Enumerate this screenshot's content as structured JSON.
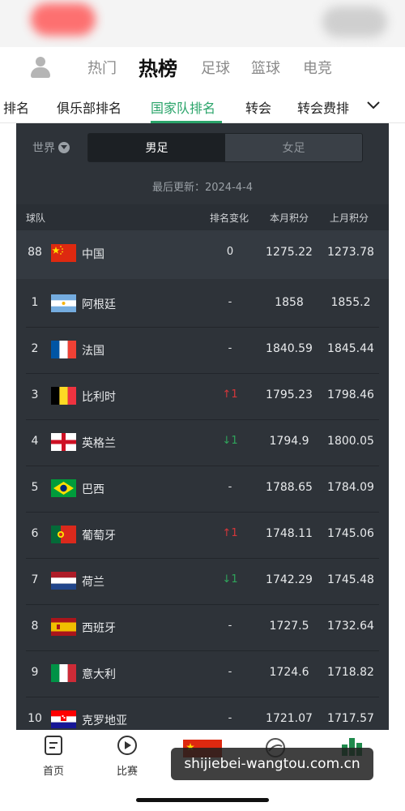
{
  "top_tabs": [
    "热门",
    "热榜",
    "足球",
    "篮球",
    "电竞"
  ],
  "sub_tabs": [
    "排名",
    "俱乐部排名",
    "国家队排名",
    "转会",
    "转会费排"
  ],
  "filter": {
    "region": "世界",
    "segments": [
      "男足",
      "女足"
    ]
  },
  "updated": "最后更新：2024-4-4",
  "columns": {
    "team": "球队",
    "change": "排名变化",
    "current": "本月积分",
    "previous": "上月积分"
  },
  "teams": [
    {
      "rank": "88",
      "flag": "china-flag",
      "name": "中国",
      "change": "0",
      "current": "1275.22",
      "previous": "1273.78"
    },
    {
      "rank": "1",
      "flag": "argentina-flag",
      "name": "阿根廷",
      "change": "-",
      "current": "1858",
      "previous": "1855.2"
    },
    {
      "rank": "2",
      "flag": "france-flag",
      "name": "法国",
      "change": "-",
      "current": "1840.59",
      "previous": "1845.44"
    },
    {
      "rank": "3",
      "flag": "belgium-flag",
      "name": "比利时",
      "change": "1",
      "change_dir": "up",
      "current": "1795.23",
      "previous": "1798.46"
    },
    {
      "rank": "4",
      "flag": "england-flag",
      "name": "英格兰",
      "change": "1",
      "change_dir": "down",
      "current": "1794.9",
      "previous": "1800.05"
    },
    {
      "rank": "5",
      "flag": "brazil-flag",
      "name": "巴西",
      "change": "-",
      "current": "1788.65",
      "previous": "1784.09"
    },
    {
      "rank": "6",
      "flag": "portugal-flag",
      "name": "葡萄牙",
      "change": "1",
      "change_dir": "up",
      "current": "1748.11",
      "previous": "1745.06"
    },
    {
      "rank": "7",
      "flag": "netherlands-flag",
      "name": "荷兰",
      "change": "1",
      "change_dir": "down",
      "current": "1742.29",
      "previous": "1745.48"
    },
    {
      "rank": "8",
      "flag": "spain-flag",
      "name": "西班牙",
      "change": "-",
      "current": "1727.5",
      "previous": "1732.64"
    },
    {
      "rank": "9",
      "flag": "italy-flag",
      "name": "意大利",
      "change": "-",
      "current": "1724.6",
      "previous": "1718.82"
    },
    {
      "rank": "10",
      "flag": "croatia-flag",
      "name": "克罗地亚",
      "change": "-",
      "current": "1721.07",
      "previous": "1717.57"
    }
  ],
  "bottom_nav": [
    {
      "label": "首页",
      "icon": "home-doc-icon"
    },
    {
      "label": "比赛",
      "icon": "play-circle-icon"
    }
  ],
  "watermark": "shijiebei-wangtou.com.cn",
  "colors": {
    "accent_green": "#2aa46a",
    "up": "#d4363a",
    "down": "#2fa55b",
    "panel": "#2e3339"
  }
}
